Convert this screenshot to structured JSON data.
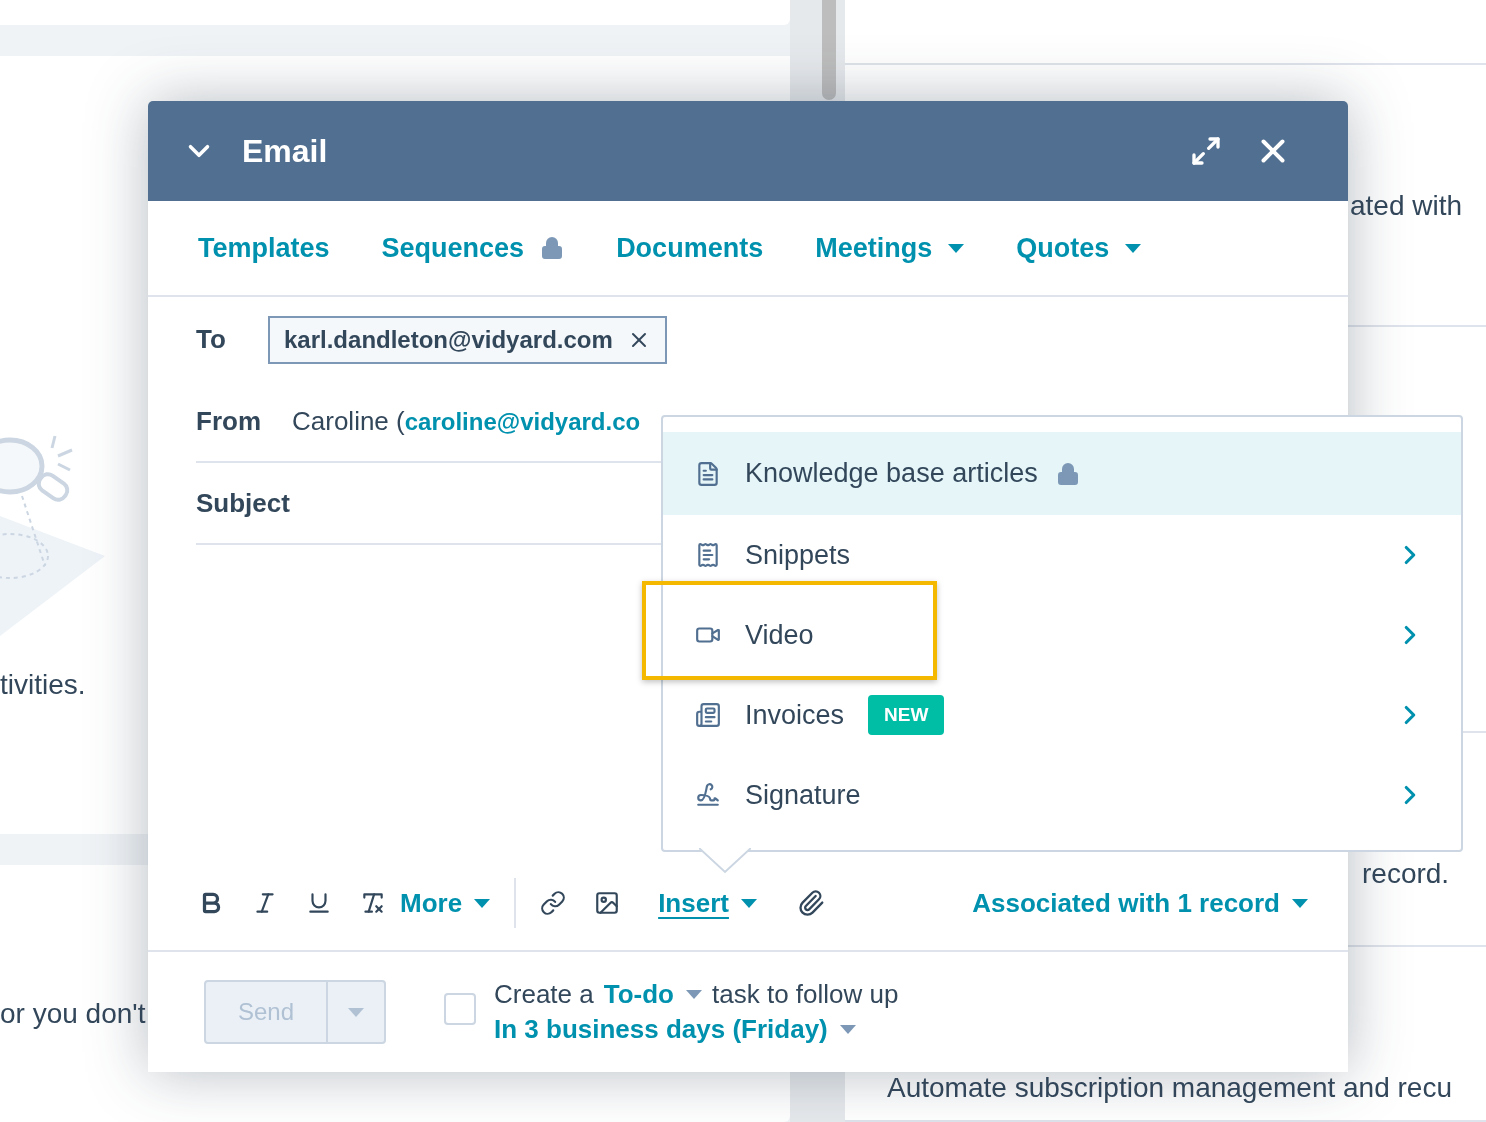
{
  "background": {
    "left_texts": [
      "tivities.",
      "or you don't"
    ],
    "right_texts": [
      "ated with",
      "record.",
      "Automate subscription management and recu"
    ]
  },
  "email_modal": {
    "title": "Email",
    "tabs": [
      {
        "label": "Templates",
        "kind": "plain"
      },
      {
        "label": "Sequences",
        "kind": "locked"
      },
      {
        "label": "Documents",
        "kind": "plain"
      },
      {
        "label": "Meetings",
        "kind": "menu"
      },
      {
        "label": "Quotes",
        "kind": "menu"
      }
    ],
    "to": {
      "label": "To",
      "recipients": [
        "karl.dandleton@vidyard.com"
      ]
    },
    "from": {
      "label": "From",
      "name": "Caroline (",
      "email": "caroline@vidyard.co"
    },
    "subject": {
      "label": "Subject"
    },
    "toolbar": {
      "more": "More",
      "insert": {
        "label": "Insert",
        "active": true
      },
      "associated": "Associated with 1 record"
    },
    "insert_menu": {
      "items": [
        {
          "label": "Knowledge base articles",
          "kind": "locked",
          "selected": true,
          "highlighted": false
        },
        {
          "label": "Snippets",
          "kind": "submenu",
          "selected": false,
          "highlighted": false
        },
        {
          "label": "Video",
          "kind": "submenu",
          "selected": false,
          "highlighted": true
        },
        {
          "label": "Invoices",
          "kind": "submenu",
          "selected": false,
          "highlighted": false,
          "badge": "NEW"
        },
        {
          "label": "Signature",
          "kind": "submenu",
          "selected": false,
          "highlighted": false
        }
      ]
    },
    "footer": {
      "send": {
        "label": "Send",
        "disabled": true
      },
      "follow_up": {
        "checked": false,
        "prefix": "Create a",
        "task_type": "To-do",
        "suffix": "task to follow up",
        "due": "In 3 business days (Friday)"
      }
    }
  }
}
